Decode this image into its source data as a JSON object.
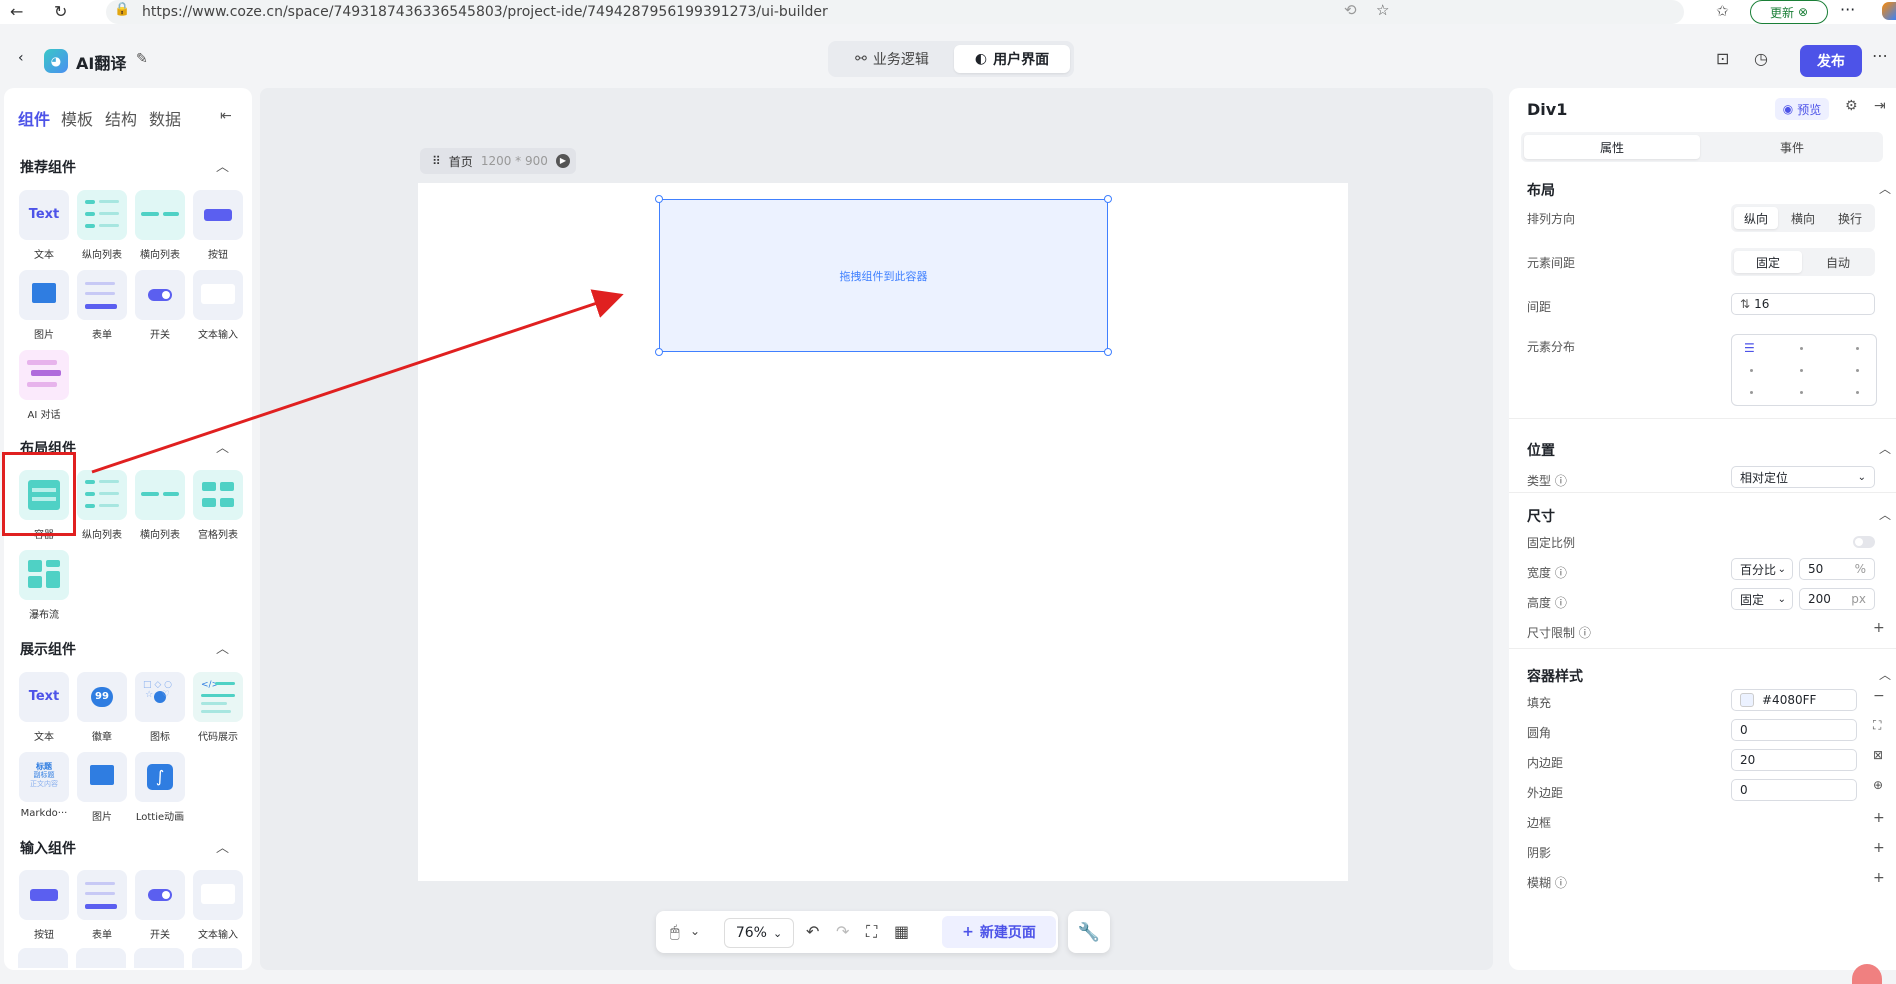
{
  "browser": {
    "url": "https://www.coze.cn/space/7493187436336545803/project-ide/7494287956199391273/ui-builder",
    "update_label": "更新"
  },
  "header": {
    "app_title": "AI翻译",
    "mode_tabs": [
      "业务逻辑",
      "用户界面"
    ],
    "active_mode": "用户界面",
    "publish_label": "发布"
  },
  "left_panel": {
    "tabs": [
      "组件",
      "模板",
      "结构",
      "数据"
    ],
    "active_tab": "组件",
    "sections": [
      {
        "title": "推荐组件",
        "items": [
          "文本",
          "纵向列表",
          "横向列表",
          "按钮",
          "图片",
          "表单",
          "开关",
          "文本输入",
          "AI 对话"
        ]
      },
      {
        "title": "布局组件",
        "items": [
          "容器",
          "纵向列表",
          "横向列表",
          "宫格列表",
          "瀑布流"
        ]
      },
      {
        "title": "展示组件",
        "items": [
          "文本",
          "徽章",
          "图标",
          "代码展示",
          "Markdo···",
          "图片",
          "Lottie动画"
        ]
      },
      {
        "title": "输入组件",
        "items": [
          "按钮",
          "表单",
          "开关",
          "文本输入"
        ]
      }
    ],
    "tile_text": "Text",
    "badge_text": "99",
    "markdown_tile": [
      "标题",
      "副标题",
      "正文内容"
    ]
  },
  "canvas": {
    "page_name": "首页",
    "page_size": "1200 * 900",
    "drop_hint": "拖拽组件到此容器",
    "zoom": "76%",
    "new_page_label": "新建页面"
  },
  "right_panel": {
    "element_name": "Div1",
    "preview_label": "预览",
    "tabs": [
      "属性",
      "事件"
    ],
    "layout": {
      "title": "布局",
      "direction_label": "排列方向",
      "direction_options": [
        "纵向",
        "横向",
        "换行"
      ],
      "spacing_label": "元素间距",
      "spacing_options": [
        "固定",
        "自动"
      ],
      "gap_label": "间距",
      "gap_value": "16",
      "distribution_label": "元素分布"
    },
    "position": {
      "title": "位置",
      "type_label": "类型",
      "type_value": "相对定位"
    },
    "size": {
      "title": "尺寸",
      "ratio_label": "固定比例",
      "width_label": "宽度",
      "width_mode": "百分比",
      "width_value": "50",
      "width_unit": "%",
      "height_label": "高度",
      "height_mode": "固定",
      "height_value": "200",
      "height_unit": "px",
      "limit_label": "尺寸限制"
    },
    "style": {
      "title": "容器样式",
      "fill_label": "填充",
      "fill_value": "#4080FF",
      "radius_label": "圆角",
      "radius_value": "0",
      "padding_label": "内边距",
      "padding_value": "20",
      "margin_label": "外边距",
      "margin_value": "0",
      "border_label": "边框",
      "shadow_label": "阴影",
      "blur_label": "模糊"
    }
  },
  "colors": {
    "accent": "#4d53e8",
    "selection": "#4080ff",
    "annotation": "#e02020"
  }
}
